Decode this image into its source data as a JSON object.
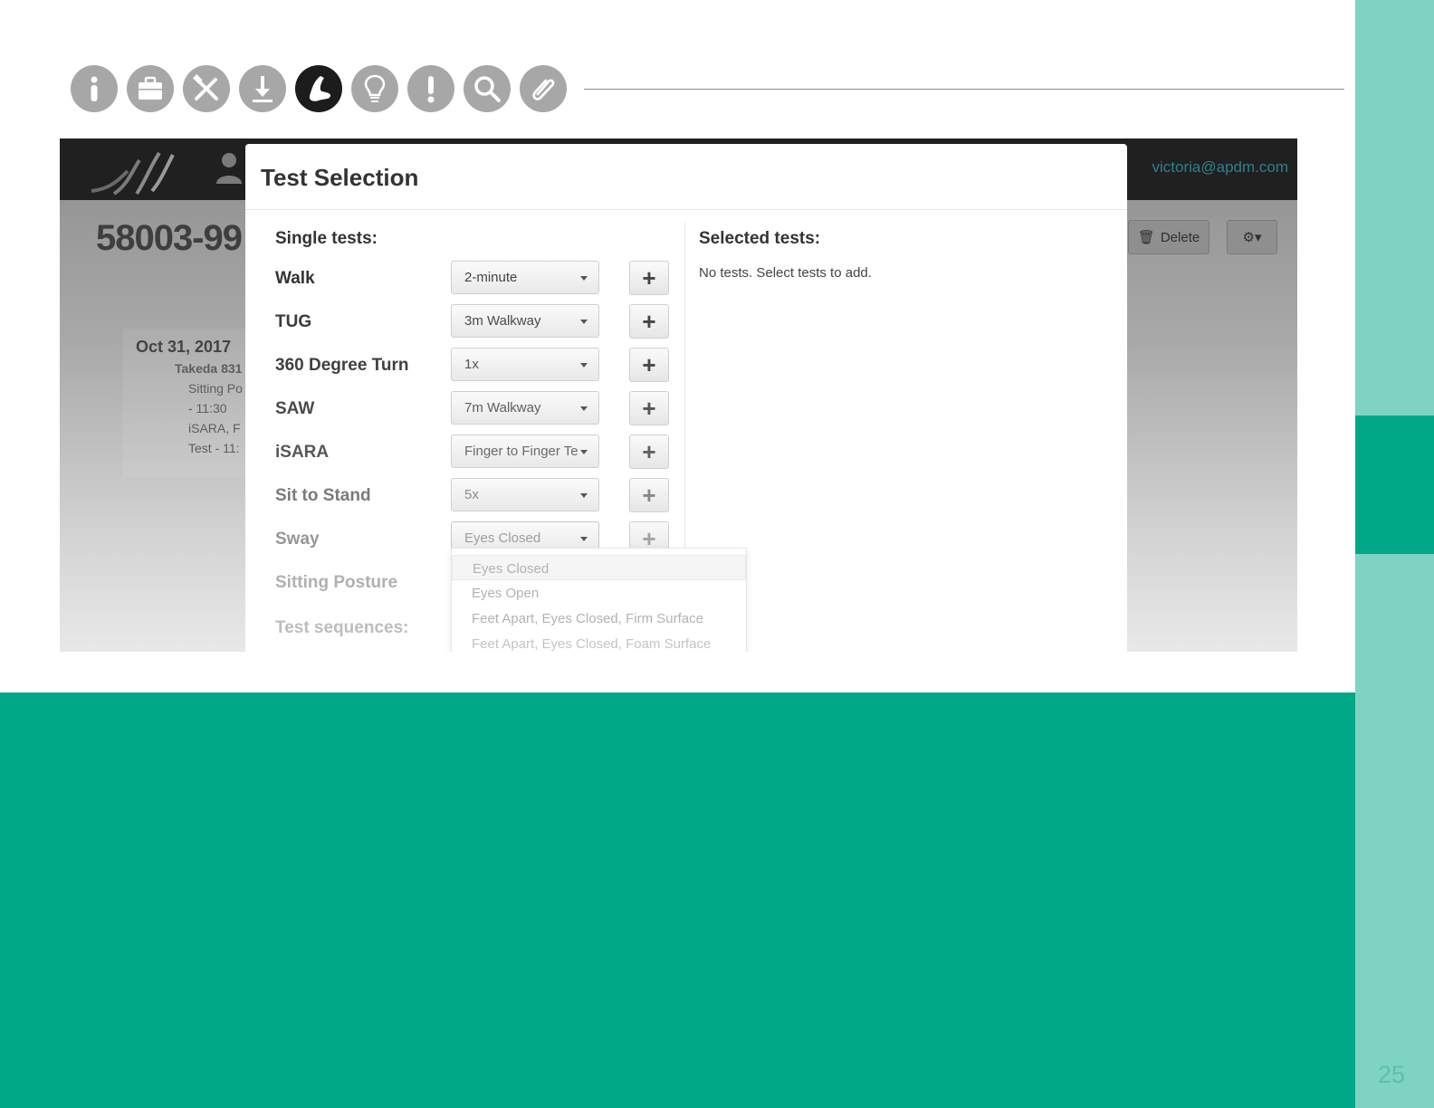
{
  "page": {
    "number": "25"
  },
  "icons": [
    {
      "name": "info-icon",
      "active": false
    },
    {
      "name": "briefcase-icon",
      "active": false
    },
    {
      "name": "tools-icon",
      "active": false
    },
    {
      "name": "download-icon",
      "active": false
    },
    {
      "name": "foot-icon",
      "active": true
    },
    {
      "name": "lightbulb-icon",
      "active": false
    },
    {
      "name": "exclamation-icon",
      "active": false
    },
    {
      "name": "search-icon",
      "active": false
    },
    {
      "name": "paperclip-icon",
      "active": false
    }
  ],
  "app": {
    "user_email": "victoria@apdm.com",
    "record_title": "58003-99",
    "delete_label": "Delete",
    "session": {
      "date": "Oct 31, 2017",
      "lines": [
        "Takeda 831",
        "Sitting Po",
        "- 11:30",
        "iSARA, F",
        "Test - 11:"
      ]
    }
  },
  "modal": {
    "title": "Test Selection",
    "single_tests_label": "Single tests:",
    "selected_tests_label": "Selected tests:",
    "empty_message": "No tests. Select tests to add.",
    "tests": [
      {
        "label": "Walk",
        "value": "2-minute"
      },
      {
        "label": "TUG",
        "value": "3m Walkway"
      },
      {
        "label": "360 Degree Turn",
        "value": "1x"
      },
      {
        "label": "SAW",
        "value": "7m Walkway"
      },
      {
        "label": "iSARA",
        "value": "Finger to Finger Te"
      },
      {
        "label": "Sit to Stand",
        "value": "5x"
      },
      {
        "label": "Sway",
        "value": "Eyes Closed"
      },
      {
        "label": "Sitting Posture",
        "value": ""
      }
    ],
    "add_symbol": "+",
    "test_sequences_label": "Test sequences:",
    "dropdown_options": [
      "Eyes Closed",
      "Eyes Open",
      "Feet Apart, Eyes Closed, Firm Surface",
      "Feet Apart, Eyes Closed, Foam Surface"
    ]
  },
  "colors": {
    "accent_dark": "#00a887",
    "accent_light": "#7fd3c2",
    "icon_gray": "#a7a7a7",
    "icon_active": "#1c1c1c"
  }
}
